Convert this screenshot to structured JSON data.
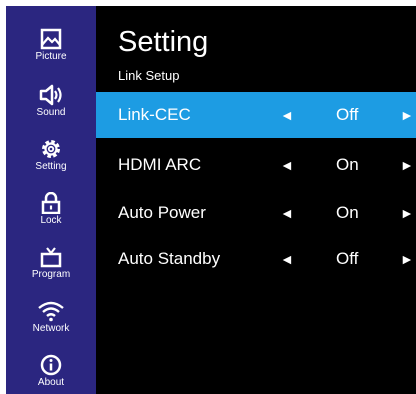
{
  "nav": {
    "items": [
      {
        "label": "Picture",
        "icon": "picture-icon"
      },
      {
        "label": "Sound",
        "icon": "speaker-icon"
      },
      {
        "label": "Setting",
        "icon": "gear-icon"
      },
      {
        "label": "Lock",
        "icon": "lock-icon"
      },
      {
        "label": "Program",
        "icon": "tv-icon"
      },
      {
        "label": "Network",
        "icon": "wifi-icon"
      },
      {
        "label": "About",
        "icon": "info-icon"
      }
    ]
  },
  "header": {
    "title": "Setting",
    "section": "Link Setup"
  },
  "settings": {
    "rows": [
      {
        "label": "Link-CEC",
        "value": "Off",
        "selected": true
      },
      {
        "label": "HDMI ARC",
        "value": "On",
        "selected": false
      },
      {
        "label": "Auto Power",
        "value": "On",
        "selected": false
      },
      {
        "label": "Auto Standby",
        "value": "Off",
        "selected": false
      }
    ],
    "left_arrow": "◄",
    "right_arrow": "►"
  },
  "colors": {
    "sidebar": "#2b2680",
    "highlight": "#1d9ce3",
    "background": "#000000"
  }
}
